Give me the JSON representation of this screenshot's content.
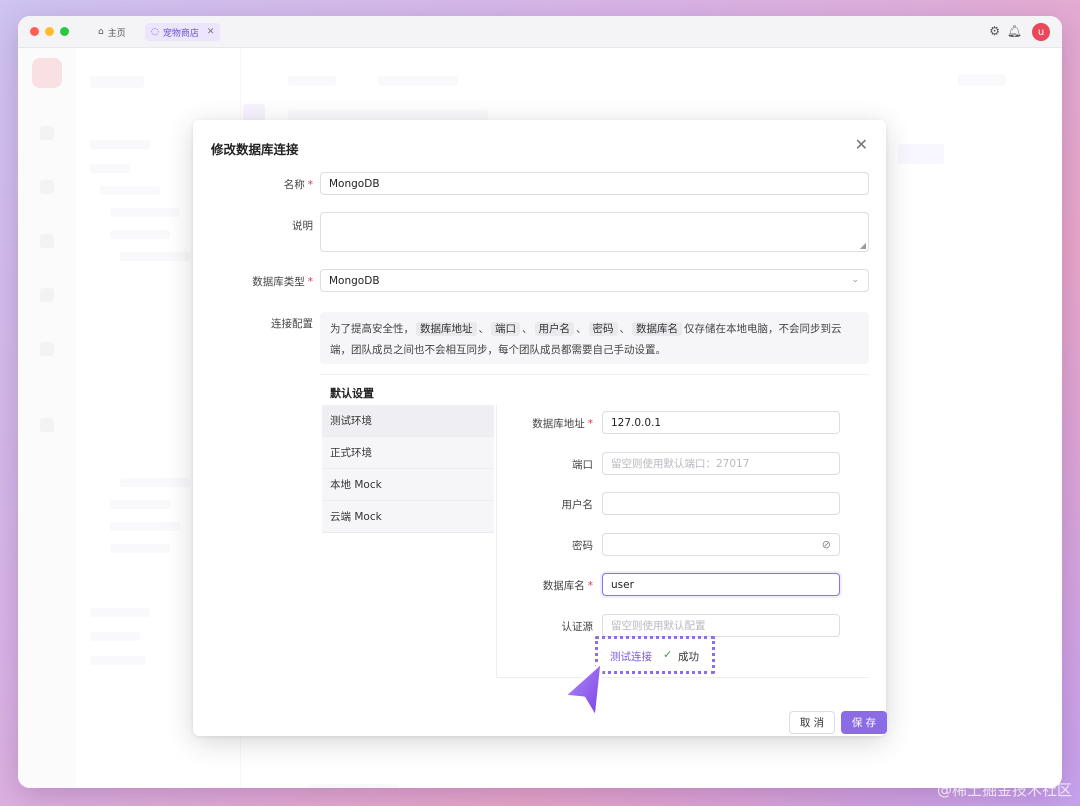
{
  "titlebar": {
    "tab_home": "主页",
    "tab_shop": "宠物商店",
    "tab_close": "✕",
    "avatar_letter": "u"
  },
  "modal": {
    "title": "修改数据库连接",
    "close": "✕",
    "fields": {
      "name_label": "名称",
      "name_value": "MongoDB",
      "desc_label": "说明",
      "desc_value": "",
      "dbtype_label": "数据库类型",
      "dbtype_value": "MongoDB",
      "conn_label": "连接配置"
    },
    "notice": {
      "prefix": "为了提高安全性，",
      "chips": [
        "数据库地址",
        "端口",
        "用户名",
        "密码",
        "数据库名"
      ],
      "suffix": "仅存储在本地电脑，不会同步到云端，团队成员之间也不会相互同步，每个团队成员都需要自己手动设置。"
    },
    "panel": {
      "title": "默认设置",
      "environments": [
        "测试环境",
        "正式环境",
        "本地 Mock",
        "云端 Mock"
      ],
      "form": {
        "host_label": "数据库地址",
        "host_value": "127.0.0.1",
        "port_label": "端口",
        "port_placeholder": "留空则使用默认端口：27017",
        "user_label": "用户名",
        "user_value": "",
        "pwd_label": "密码",
        "pwd_value": "",
        "dbname_label": "数据库名",
        "dbname_value": "user",
        "auth_label": "认证源",
        "auth_placeholder": "留空则使用默认配置"
      },
      "test_link": "测试连接",
      "test_result": "成功"
    },
    "buttons": {
      "cancel": "取 消",
      "save": "保 存"
    }
  },
  "watermark": "@稀土掘金技术社区",
  "colors": {
    "accent": "#8b6ce6",
    "required": "#e0344b",
    "success": "#3b9a5a"
  }
}
